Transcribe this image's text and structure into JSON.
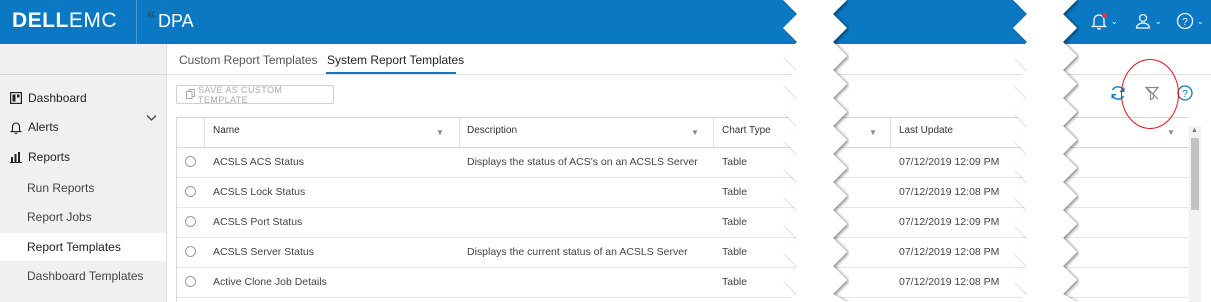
{
  "header": {
    "logo_bold": "DELL",
    "logo_light": "EMC",
    "product": "DPA",
    "icons": [
      "bell-icon",
      "user-icon",
      "help-icon"
    ],
    "accent_color": "#0a78c2"
  },
  "sidebar": {
    "collapse_label": "«",
    "items": [
      {
        "label": "Dashboard",
        "icon": "dashboard-icon"
      },
      {
        "label": "Alerts",
        "icon": "bell-icon"
      },
      {
        "label": "Reports",
        "icon": "bar-chart-icon",
        "expanded": true
      }
    ],
    "report_subitems": [
      {
        "label": "Run Reports"
      },
      {
        "label": "Report Jobs"
      },
      {
        "label": "Report Templates",
        "active": true
      },
      {
        "label": "Dashboard Templates"
      }
    ]
  },
  "tabs": [
    {
      "label": "Custom Report Templates"
    },
    {
      "label": "System Report Templates",
      "active": true
    }
  ],
  "toolbar": {
    "save_label": "SAVE AS CUSTOM TEMPLATE",
    "icons": [
      "refresh-icon",
      "clear-filter-icon",
      "help-icon"
    ]
  },
  "table": {
    "columns": [
      "Name",
      "Description",
      "Chart Type",
      "Last Update"
    ],
    "rows": [
      {
        "name": "ACSLS ACS Status",
        "description": "Displays the status of ACS's on an ACSLS Server",
        "chart_type": "Table",
        "last_update": "07/12/2019 12:09 PM"
      },
      {
        "name": "ACSLS Lock Status",
        "description": "",
        "chart_type": "Table",
        "last_update": "07/12/2019 12:08 PM"
      },
      {
        "name": "ACSLS Port Status",
        "description": "",
        "chart_type": "Table",
        "last_update": "07/12/2019 12:09 PM"
      },
      {
        "name": "ACSLS Server Status",
        "description": "Displays the current status of an ACSLS Server",
        "chart_type": "Table",
        "last_update": "07/12/2019 12:08 PM"
      },
      {
        "name": "Active Clone Job Details",
        "description": "",
        "chart_type": "Table",
        "last_update": "07/12/2019 12:08 PM"
      }
    ]
  },
  "annotation": {
    "highlight_color": "#e0141e"
  }
}
